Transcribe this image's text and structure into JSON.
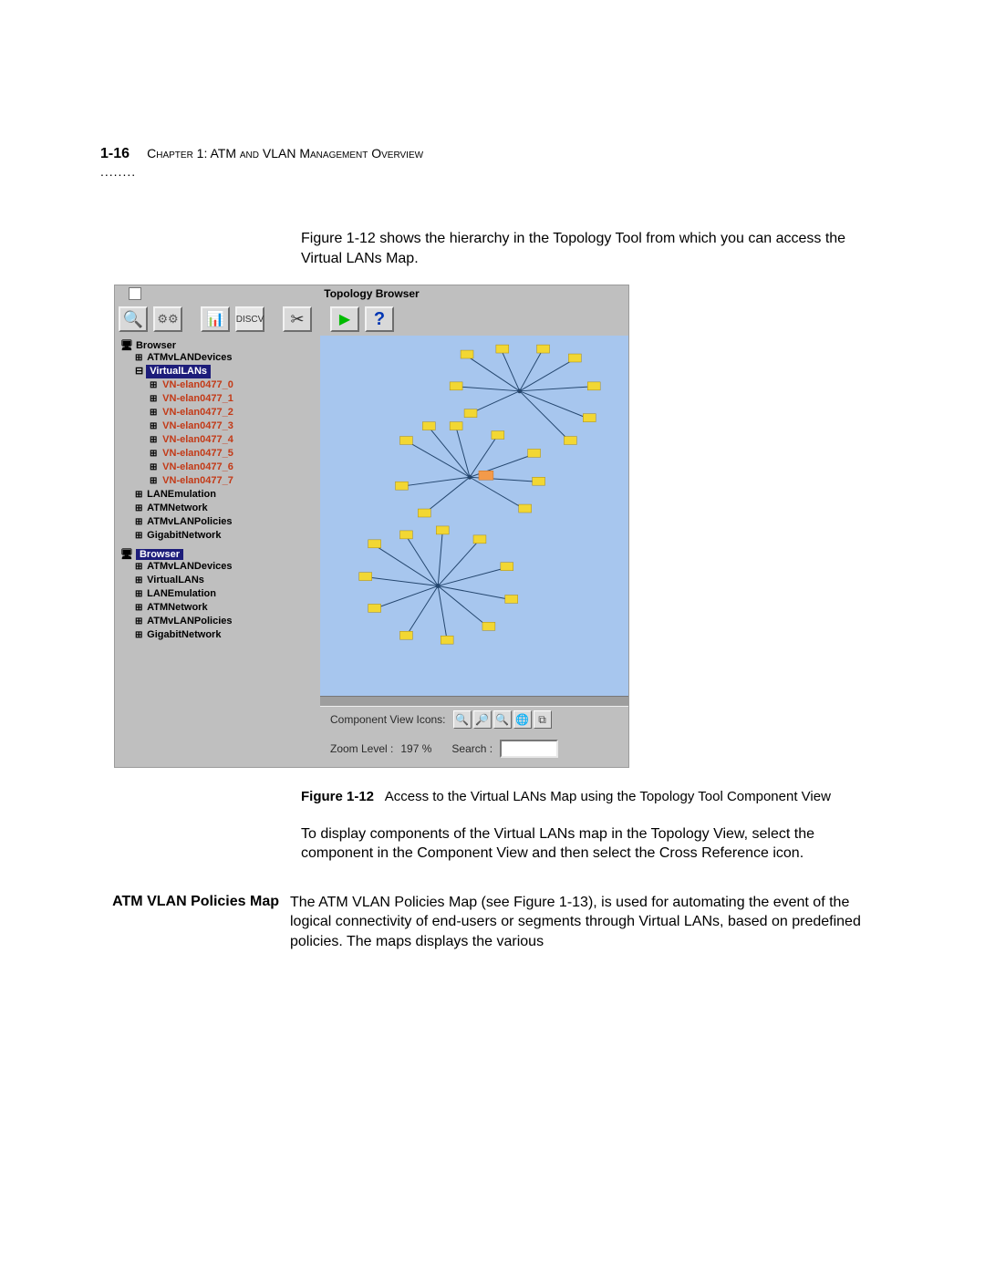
{
  "header": {
    "page_num": "1-16",
    "chapter": "Chapter 1: ATM and VLAN Management Overview",
    "dots": "........"
  },
  "intro": "Figure 1-12 shows the hierarchy in the Topology Tool from which you can access the Virtual LANs Map.",
  "topology_window": {
    "title": "Topology Browser",
    "toolbar_icons": [
      "magnify-icon",
      "config-icon",
      "barchart-icon",
      "discovery-icon",
      "cut-icon",
      "run-icon",
      "help-icon"
    ],
    "trees": [
      {
        "root": "Browser",
        "items": [
          {
            "label": "ATMvLANDevices",
            "expandable": true,
            "level": 1,
            "kind": "folder"
          },
          {
            "label": "VirtualLANs",
            "expandable": true,
            "level": 1,
            "kind": "folder",
            "selected": true,
            "children": [
              {
                "label": "VN-elan0477_0"
              },
              {
                "label": "VN-elan0477_1"
              },
              {
                "label": "VN-elan0477_2"
              },
              {
                "label": "VN-elan0477_3"
              },
              {
                "label": "VN-elan0477_4"
              },
              {
                "label": "VN-elan0477_5"
              },
              {
                "label": "VN-elan0477_6"
              },
              {
                "label": "VN-elan0477_7"
              }
            ]
          },
          {
            "label": "LANEmulation",
            "expandable": true,
            "level": 1,
            "kind": "folder"
          },
          {
            "label": "ATMNetwork",
            "expandable": true,
            "level": 1,
            "kind": "folder"
          },
          {
            "label": "ATMvLANPolicies",
            "expandable": true,
            "level": 1,
            "kind": "folder"
          },
          {
            "label": "GigabitNetwork",
            "expandable": true,
            "level": 1,
            "kind": "folder"
          }
        ]
      },
      {
        "root": "Browser",
        "root_selected": true,
        "items": [
          {
            "label": "ATMvLANDevices",
            "expandable": true,
            "level": 1,
            "kind": "folder"
          },
          {
            "label": "VirtualLANs",
            "expandable": true,
            "level": 1,
            "kind": "folder"
          },
          {
            "label": "LANEmulation",
            "expandable": true,
            "level": 1,
            "kind": "folder"
          },
          {
            "label": "ATMNetwork",
            "expandable": true,
            "level": 1,
            "kind": "folder"
          },
          {
            "label": "ATMvLANPolicies",
            "expandable": true,
            "level": 1,
            "kind": "folder"
          },
          {
            "label": "GigabitNetwork",
            "expandable": true,
            "level": 1,
            "kind": "folder"
          }
        ]
      }
    ],
    "bottom": {
      "icons_label": "Component View Icons:",
      "zoom_label": "Zoom Level :",
      "zoom_value": "197 %",
      "search_label": "Search :"
    }
  },
  "figure_caption": {
    "label": "Figure 1-12",
    "text": "Access to the Virtual LANs Map using the Topology Tool Component View"
  },
  "midtext": "To display components of the Virtual LANs map in the Topology View, select the component in the Component View and then select the Cross Reference icon.",
  "section": {
    "heading": "ATM VLAN Policies Map",
    "body": "The ATM VLAN Policies Map (see Figure 1-13), is used for automating the event of the logical connectivity of end-users or segments through Virtual LANs, based on predefined policies. The maps displays the various"
  }
}
